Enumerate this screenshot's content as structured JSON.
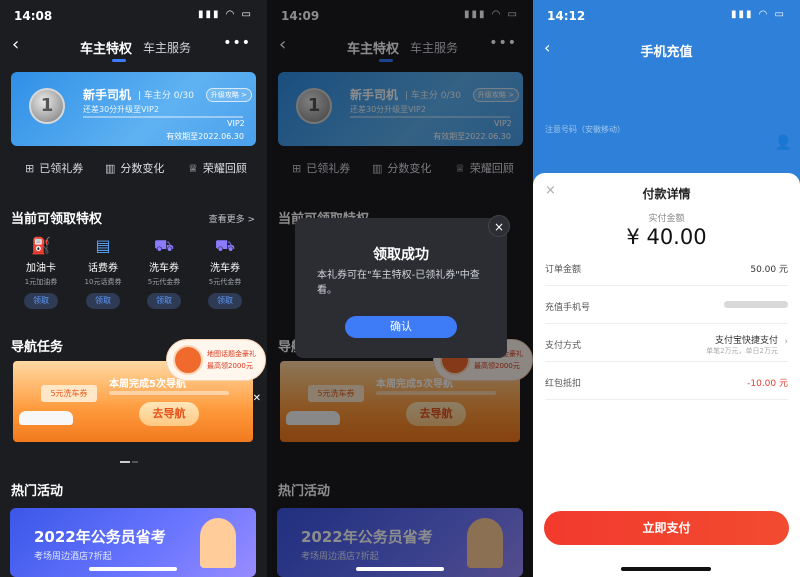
{
  "panel1": {
    "status_time": "14:08",
    "nav": {
      "tab_privileges": "车主特权",
      "tab_services": "车主服务",
      "more": "•••"
    },
    "vip_card": {
      "medal": "1",
      "level": "新手司机",
      "score": "| 车主分 0/30",
      "hint": "还差30分升级至VIP2",
      "next_level": "VIP2",
      "expiry": "有效期至2022.06.30",
      "strategy_button": "升级攻略 >"
    },
    "quick_links": [
      "已领礼券",
      "分数变化",
      "荣耀回顾"
    ],
    "privileges": {
      "title": "当前可领取特权",
      "see_more": "查看更多 >",
      "items": [
        {
          "name": "加油卡",
          "desc": "1元加油券",
          "button": "领取"
        },
        {
          "name": "话费券",
          "desc": "10元话费券",
          "button": "领取"
        },
        {
          "name": "洗车券",
          "desc": "5元代金券",
          "button": "领取"
        },
        {
          "name": "洗车券",
          "desc": "5元代金券",
          "button": "领取"
        }
      ]
    },
    "nav_task": {
      "title": "导航任务",
      "banner_title": "本周完成5次导航",
      "coupon": "5元洗车券",
      "go_button": "去导航"
    },
    "float_promo": {
      "line1": "地图话题金豪礼",
      "line2": "最高领2000元"
    },
    "hot": {
      "title": "热门活动",
      "banner_title": "2022年公务员省考",
      "banner_sub": "考场周边酒店7折起"
    }
  },
  "panel2": {
    "status_time": "14:09",
    "modal": {
      "title": "领取成功",
      "body": "本礼券可在\"车主特权-已领礼券\"中查看。",
      "confirm": "确认",
      "close": "×"
    }
  },
  "panel3": {
    "status_time": "14:12",
    "title": "手机充值",
    "ghost_text": "注意号码（安徽移动）",
    "sheet": {
      "close": "×",
      "title": "付款详情",
      "paid_label": "实付金额",
      "amount": "¥ 40.00",
      "rows": [
        {
          "label": "订单金额",
          "value": "50.00 元"
        },
        {
          "label": "充值手机号",
          "value": ""
        },
        {
          "label": "支付方式",
          "value": "支付宝快捷支付",
          "sub": "单笔2万元，单日2万元"
        },
        {
          "label": "红包抵扣",
          "value": "-10.00 元"
        }
      ],
      "pay_button": "立即支付"
    }
  },
  "colors": {
    "accent_blue": "#3d7bf7",
    "pay_red": "#f23a2d",
    "dark_bg": "#1c1d21"
  }
}
